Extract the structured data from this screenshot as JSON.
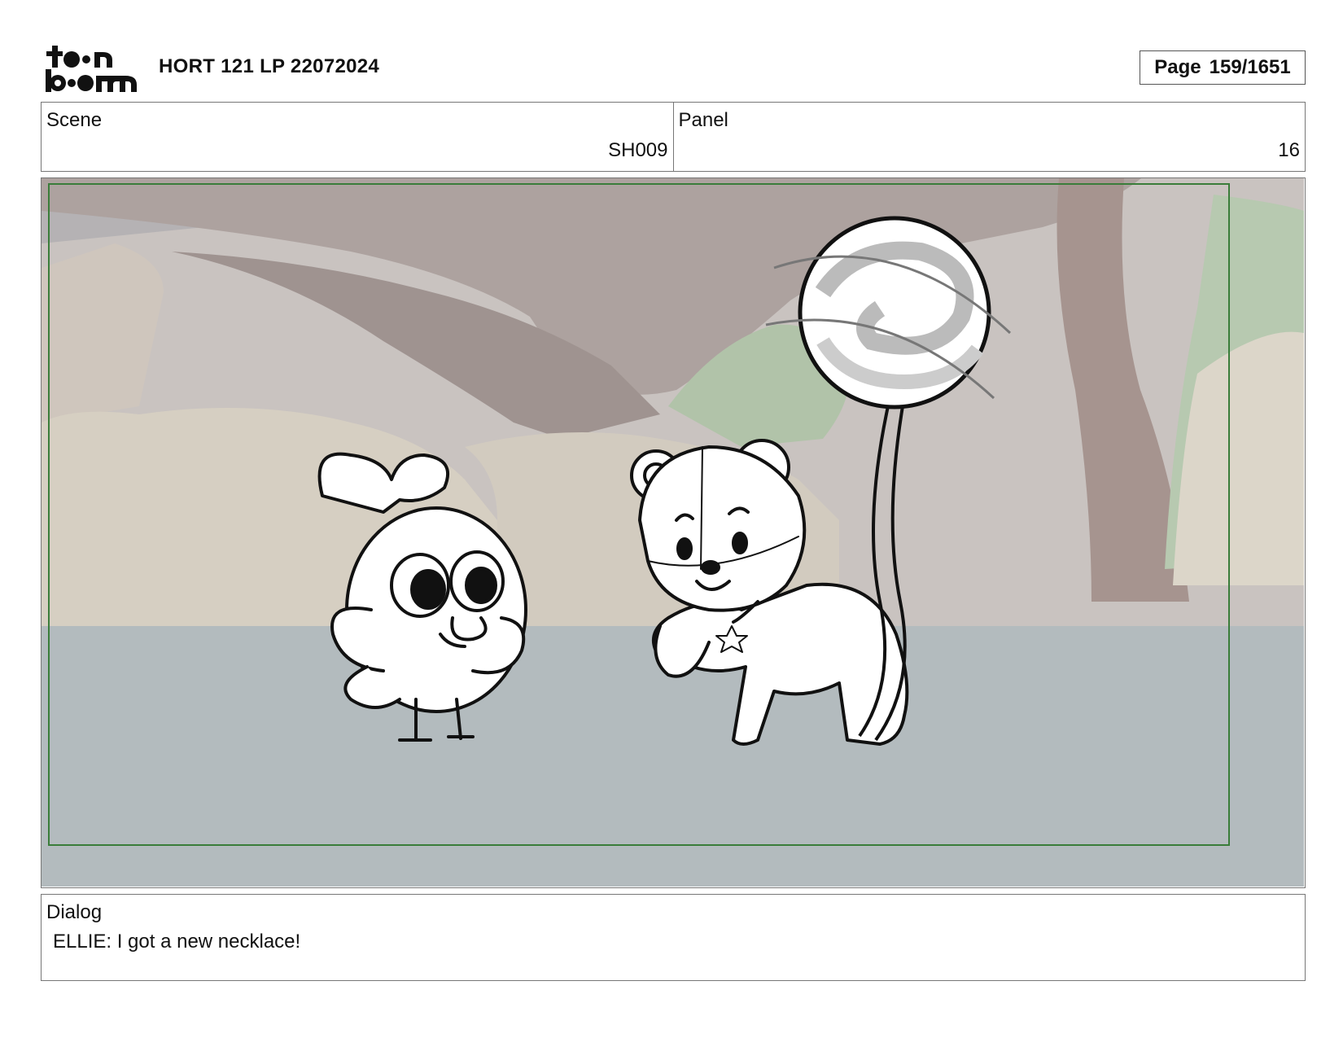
{
  "header": {
    "logo_text": "toon boom",
    "title": "HORT 121 LP 22072024",
    "page_label": "Page",
    "page_value": "159/1651"
  },
  "scene": {
    "label": "Scene",
    "value": "SH009"
  },
  "panel": {
    "label": "Panel",
    "value": "16"
  },
  "dialog": {
    "label": "Dialog",
    "text": "ELLIE: I got a new necklace!"
  },
  "colors": {
    "safe_frame": "#3a7d3a",
    "ground": "#b3bbbe",
    "background_tree": "#ada29f",
    "rocks": "#d6cfc2",
    "foliage": "#b7c9b0"
  }
}
